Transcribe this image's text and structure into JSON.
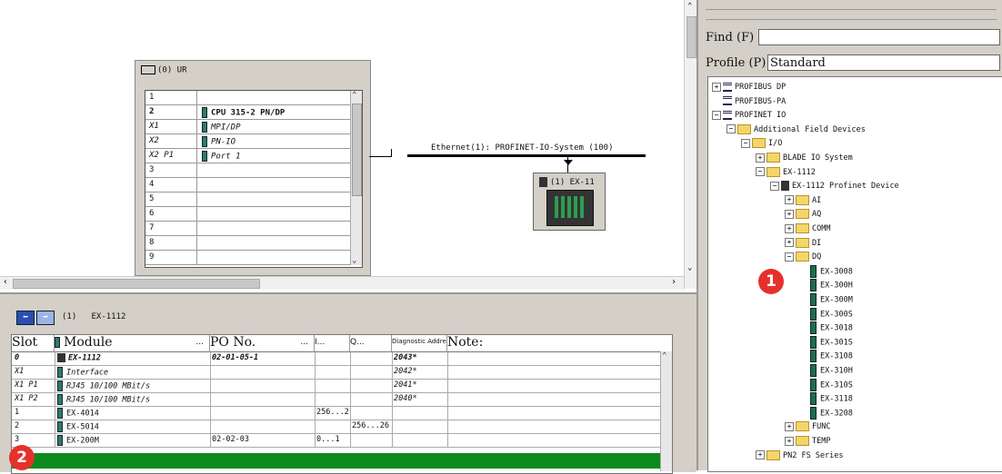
{
  "rack": {
    "title": "(0) UR",
    "rows": [
      {
        "slot": "1",
        "module": ""
      },
      {
        "slot": "2",
        "module": "CPU 315-2 PN/DP"
      },
      {
        "slot": "X1",
        "module": "MPI/DP"
      },
      {
        "slot": "X2",
        "module": "PN-IO"
      },
      {
        "slot": "X2 P1",
        "module": "Port 1"
      },
      {
        "slot": "3",
        "module": ""
      },
      {
        "slot": "4",
        "module": ""
      },
      {
        "slot": "5",
        "module": ""
      },
      {
        "slot": "6",
        "module": ""
      },
      {
        "slot": "7",
        "module": ""
      },
      {
        "slot": "8",
        "module": ""
      },
      {
        "slot": "9",
        "module": ""
      }
    ]
  },
  "network": {
    "ethernet_label": "Ethernet(1): PROFINET-IO-System (100)",
    "device_label": "(1) EX-11"
  },
  "detail": {
    "title": "(1)   EX-1112",
    "columns": {
      "slot": "Slot",
      "module": "Module",
      "module_dots": "...",
      "po": "PO No.",
      "po_dots": "...",
      "i": "I...",
      "q": "Q...",
      "diag": "Diagnostic Address",
      "note": "Note:"
    },
    "rows": [
      {
        "slot": "0",
        "module": "EX-1112",
        "po": "02-01-05-1",
        "i": "",
        "q": "",
        "diag": "2043*",
        "style": "b"
      },
      {
        "slot": "X1",
        "module": "Interface",
        "po": "",
        "i": "",
        "q": "",
        "diag": "2042*",
        "style": "i"
      },
      {
        "slot": "X1 P1",
        "module": "RJ45 10/100 MBit/s",
        "po": "",
        "i": "",
        "q": "",
        "diag": "2041*",
        "style": "i"
      },
      {
        "slot": "X1 P2",
        "module": "RJ45 10/100 MBit/s",
        "po": "",
        "i": "",
        "q": "",
        "diag": "2040*",
        "style": "i"
      },
      {
        "slot": "1",
        "module": "EX-4014",
        "po": "",
        "i": "256...2",
        "q": "",
        "diag": "",
        "style": "n"
      },
      {
        "slot": "2",
        "module": "EX-5014",
        "po": "",
        "i": "",
        "q": "256...26",
        "diag": "",
        "style": "n"
      },
      {
        "slot": "3",
        "module": "EX-200M",
        "po": "02-02-03",
        "i": "0...1",
        "q": "",
        "diag": "",
        "style": "n"
      }
    ]
  },
  "catalog": {
    "find_label": "Find (F)",
    "find_value": "",
    "profile_label": "Profile (P)",
    "profile_value": "Standard",
    "tree": [
      {
        "label": "PROFIBUS DP",
        "level": 0,
        "pm": "+",
        "icon": "net"
      },
      {
        "label": "PROFIBUS-PA",
        "level": 0,
        "pm": "",
        "icon": "net"
      },
      {
        "label": "PROFINET IO",
        "level": 0,
        "pm": "-",
        "icon": "net"
      },
      {
        "label": "Additional Field Devices",
        "level": 1,
        "pm": "-",
        "icon": "folder"
      },
      {
        "label": "I/O",
        "level": 2,
        "pm": "-",
        "icon": "folder"
      },
      {
        "label": "BLADE IO System",
        "level": 3,
        "pm": "+",
        "icon": "folder"
      },
      {
        "label": "EX-1112",
        "level": 3,
        "pm": "-",
        "icon": "folder"
      },
      {
        "label": "EX-1112 Profinet Device",
        "level": 4,
        "pm": "-",
        "icon": "device"
      },
      {
        "label": "AI",
        "level": 5,
        "pm": "+",
        "icon": "folder"
      },
      {
        "label": "AQ",
        "level": 5,
        "pm": "+",
        "icon": "folder"
      },
      {
        "label": "COMM",
        "level": 5,
        "pm": "+",
        "icon": "folder"
      },
      {
        "label": "DI",
        "level": 5,
        "pm": "+",
        "icon": "folder"
      },
      {
        "label": "DQ",
        "level": 5,
        "pm": "-",
        "icon": "folder"
      },
      {
        "label": "EX-3008",
        "level": 6,
        "pm": "",
        "icon": "module"
      },
      {
        "label": "EX-300H",
        "level": 6,
        "pm": "",
        "icon": "module"
      },
      {
        "label": "EX-300M",
        "level": 6,
        "pm": "",
        "icon": "module"
      },
      {
        "label": "EX-300S",
        "level": 6,
        "pm": "",
        "icon": "module"
      },
      {
        "label": "EX-3018",
        "level": 6,
        "pm": "",
        "icon": "module"
      },
      {
        "label": "EX-301S",
        "level": 6,
        "pm": "",
        "icon": "module"
      },
      {
        "label": "EX-3108",
        "level": 6,
        "pm": "",
        "icon": "module"
      },
      {
        "label": "EX-310H",
        "level": 6,
        "pm": "",
        "icon": "module"
      },
      {
        "label": "EX-310S",
        "level": 6,
        "pm": "",
        "icon": "module"
      },
      {
        "label": "EX-3118",
        "level": 6,
        "pm": "",
        "icon": "module"
      },
      {
        "label": "EX-3208",
        "level": 6,
        "pm": "",
        "icon": "module"
      },
      {
        "label": "FUNC",
        "level": 5,
        "pm": "+",
        "icon": "folder"
      },
      {
        "label": "TEMP",
        "level": 5,
        "pm": "+",
        "icon": "folder"
      },
      {
        "label": "PN2 FS Series",
        "level": 3,
        "pm": "+",
        "icon": "folder"
      }
    ]
  },
  "badges": {
    "one": "1",
    "two": "2"
  },
  "colors": {
    "highlight_row": "#0f8a1e",
    "badge": "#e5312c",
    "folder": "#f3d56a"
  }
}
